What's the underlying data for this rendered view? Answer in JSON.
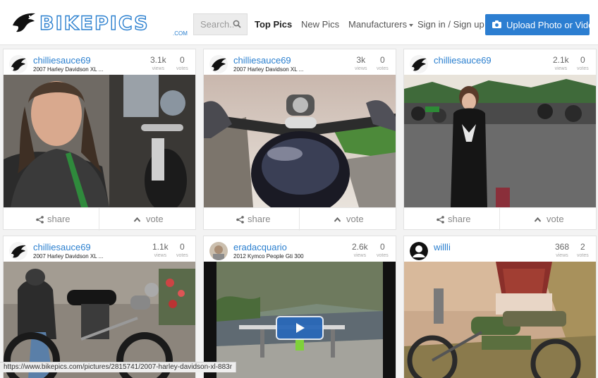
{
  "site": {
    "logo_text": "BIKEPICS",
    "logo_dotcom": ".COM"
  },
  "search": {
    "placeholder": "Search..."
  },
  "nav": {
    "top_pics": "Top Pics",
    "new_pics": "New Pics",
    "manufacturers": "Manufacturers",
    "sign_in": "Sign in / Sign up",
    "upload": "Upload Photo or Video"
  },
  "colors": {
    "brand": "#2a7fcf",
    "button": "#2c7ed1"
  },
  "labels": {
    "views": "views",
    "votes": "votes",
    "share": "share",
    "vote": "vote"
  },
  "cards": [
    {
      "user": "chilliesauce69",
      "model": "2007 Harley Davidson XL ...",
      "views": "3.1k",
      "votes": "0",
      "avatar": "eagle-avatar",
      "media": "photo"
    },
    {
      "user": "chilliesauce69",
      "model": "2007 Harley Davidson XL ...",
      "views": "3k",
      "votes": "0",
      "avatar": "eagle-avatar",
      "media": "photo"
    },
    {
      "user": "chilliesauce69",
      "model": "",
      "views": "2.1k",
      "votes": "0",
      "avatar": "eagle-avatar",
      "media": "photo"
    },
    {
      "user": "chilliesauce69",
      "model": "2007 Harley Davidson XL ...",
      "views": "1.1k",
      "votes": "0",
      "avatar": "eagle-avatar",
      "media": "photo"
    },
    {
      "user": "eradacquario",
      "model": "2012 Kymco People Gti 300",
      "views": "2.6k",
      "votes": "0",
      "avatar": "photo-avatar",
      "media": "video"
    },
    {
      "user": "willli",
      "model": "",
      "views": "368",
      "votes": "2",
      "avatar": "default-avatar",
      "media": "photo"
    }
  ],
  "status_url": "https://www.bikepics.com/pictures/2815741/2007-harley-davidson-xl-883r"
}
